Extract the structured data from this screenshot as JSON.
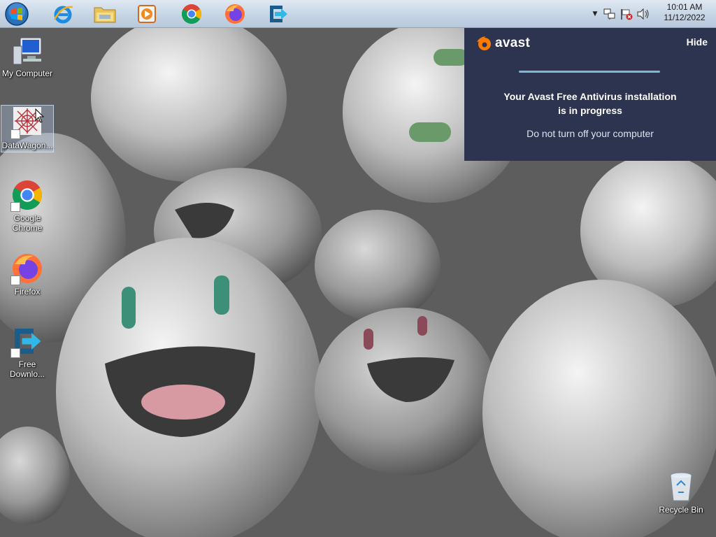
{
  "taskbar": {
    "start": {
      "icon": "windows-start-orb-icon"
    },
    "pinned": [
      {
        "name": "internet-explorer",
        "icon": "internet-explorer-icon"
      },
      {
        "name": "file-explorer",
        "icon": "folder-icon"
      },
      {
        "name": "media-player",
        "icon": "media-player-icon"
      },
      {
        "name": "google-chrome",
        "icon": "chrome-icon"
      },
      {
        "name": "firefox",
        "icon": "firefox-icon"
      },
      {
        "name": "free-download-manager",
        "icon": "download-arrow-icon"
      }
    ],
    "tray": {
      "icons": [
        "show-hidden-icons-arrow-icon",
        "network-icon",
        "action-center-flag-icon",
        "volume-icon"
      ],
      "time": "10:01 AM",
      "date": "11/12/2022"
    }
  },
  "desktop": {
    "icons": [
      {
        "label": "My Computer",
        "icon": "computer-icon"
      },
      {
        "label": "DataWagon...",
        "icon": "datawagon-icon"
      },
      {
        "label": "Google Chrome",
        "icon": "chrome-icon"
      },
      {
        "label": "Firefox",
        "icon": "firefox-icon"
      },
      {
        "label": "Free Downlo...",
        "icon": "download-arrow-icon"
      },
      {
        "label": "Recycle Bin",
        "icon": "recycle-bin-icon"
      }
    ]
  },
  "avast": {
    "logo_text": "avast",
    "hide_label": "Hide",
    "heading_line1": "Your Avast Free Antivirus installation",
    "heading_line2": "is in progress",
    "subtext": "Do not turn off your computer",
    "accent": "#ff7a00",
    "background": "#2c3450"
  }
}
